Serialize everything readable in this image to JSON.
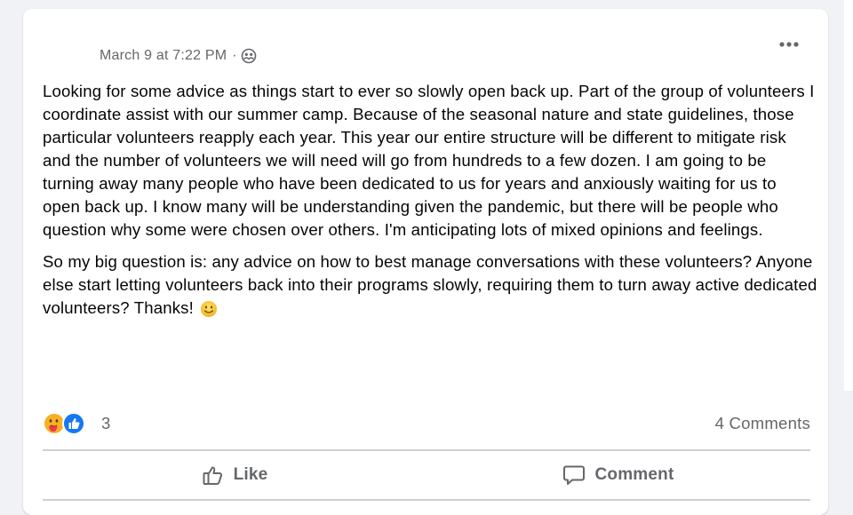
{
  "post": {
    "timestamp": "March 9 at 7:22 PM",
    "separator": "·",
    "privacy_icon": "group-privacy-icon",
    "menu_icon": "more-options-icon",
    "paragraphs": [
      "Looking for some advice as things start to ever so slowly open back up. Part of the group of volunteers I coordinate assist with our summer camp. Because of the seasonal nature and state guidelines, those particular volunteers reapply each year. This year our entire structure will be different to mitigate risk and the number of volunteers we will need will go from hundreds to a few dozen. I am going to be turning away many people who have been dedicated to us for years and anxiously waiting for us to open back up. I know many will be understanding given the pandemic, but there will be people who question why some were chosen over others. I'm anticipating lots of mixed opinions and feelings.",
      "So my big question is: any advice on how to best manage conversations with these volunteers? Anyone else start letting volunteers back into their programs slowly, requiring them to turn away active dedicated volunteers? Thanks!"
    ],
    "trailing_emoji": "smiling-face-emoji"
  },
  "stats": {
    "reaction_icons": [
      "care-reaction-icon",
      "like-reaction-icon"
    ],
    "reaction_count": "3",
    "comments_label": "4 Comments"
  },
  "actions": {
    "like_label": "Like",
    "comment_label": "Comment"
  },
  "colors": {
    "secondary_text": "#65676b",
    "primary_text": "#050505",
    "like_blue": "#1877f2",
    "care_yellow": "#f7b125",
    "divider": "#ced0d4"
  }
}
